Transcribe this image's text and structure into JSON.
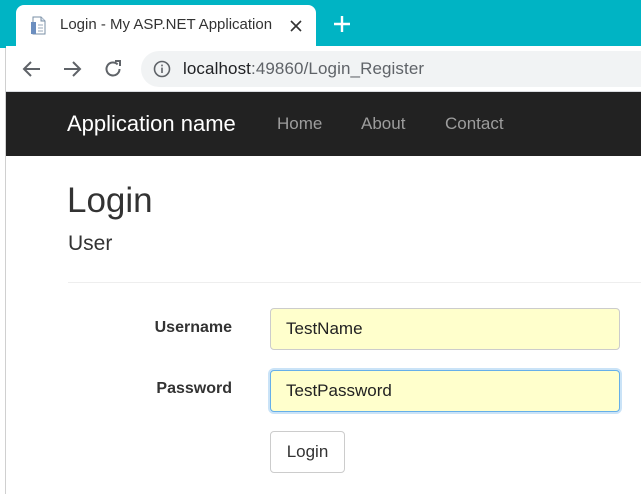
{
  "browser": {
    "tab": {
      "title": "Login - My ASP.NET Application",
      "favicon": "document-icon",
      "close_icon": "close-icon"
    },
    "new_tab_icon": "plus-icon",
    "nav": {
      "back_icon": "arrow-left-icon",
      "forward_icon": "arrow-right-icon",
      "reload_icon": "reload-icon",
      "info_icon": "info-icon"
    },
    "address": {
      "host": "localhost",
      "rest": ":49860/Login_Register"
    },
    "colors": {
      "tabstrip": "#00b4c4"
    }
  },
  "navbar": {
    "brand": "Application name",
    "links": [
      "Home",
      "About",
      "Contact"
    ],
    "colors": {
      "background": "#222222",
      "link": "#9d9d9d"
    }
  },
  "main": {
    "title": "Login",
    "subtitle": "User",
    "form": {
      "username_label": "Username",
      "username_value": "TestName",
      "password_label": "Password",
      "password_value": "TestPassword",
      "submit_label": "Login",
      "autofill_color": "#ffffcc"
    }
  }
}
